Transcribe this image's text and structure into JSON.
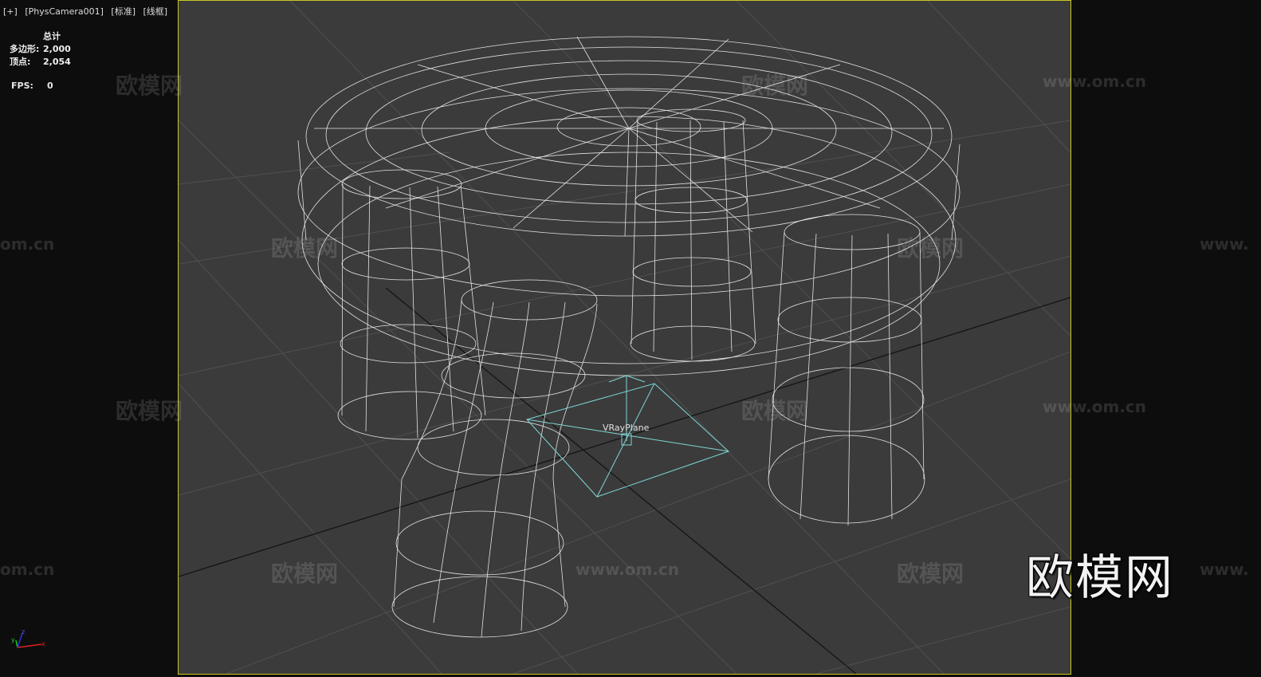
{
  "viewport": {
    "labels": [
      "[+]",
      "[PhysCamera001]",
      "[标准]",
      "[线框]"
    ]
  },
  "stats": {
    "header": "总计",
    "polygons_label": "多边形:",
    "polygons_value": "2,000",
    "vertices_label": "顶点:",
    "vertices_value": "2,054",
    "fps_label": "FPS:",
    "fps_value": "0"
  },
  "scene": {
    "object_label": "VRayPlane"
  },
  "axis": {
    "x": "x",
    "y": "y",
    "z": "z"
  },
  "watermark": {
    "cn_text": "欧模网",
    "url_text": "www.om.cn",
    "url_fragment": "om.cn",
    "url_prefix": "www."
  },
  "colors": {
    "frame_border": "#c8c81e",
    "viewport_bg": "#3b3b3b",
    "wire": "#ffffff",
    "gizmo": "#7fd6d6"
  }
}
